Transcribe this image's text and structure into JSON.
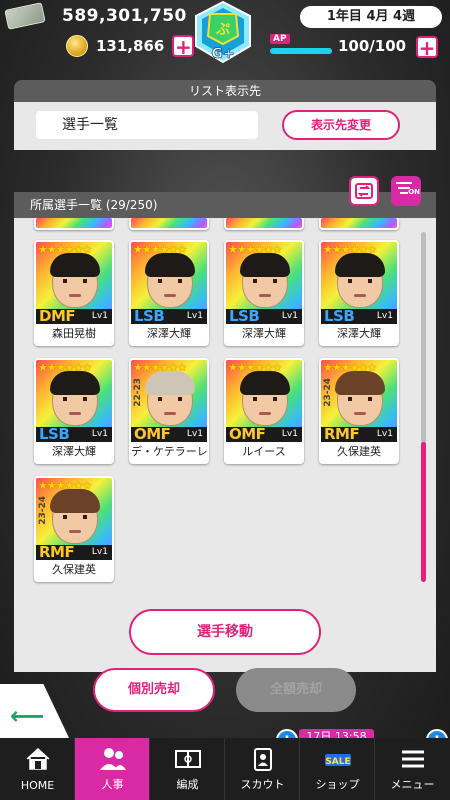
{
  "header": {
    "money": "589,301,750",
    "coins": "131,866",
    "date": "1年目 4月 4週",
    "ap_label": "AP",
    "ap_value": "100/100",
    "ap_fraction": 1.0,
    "plus": "+"
  },
  "list_destination": {
    "title": "リスト表示先",
    "selected": "選手一覧",
    "change_button": "表示先変更"
  },
  "owned": {
    "title": "所属選手一覧 (29/250)",
    "filter_on_label": "ON",
    "players": [
      {
        "position": "DMF",
        "level": "Lv1",
        "name": "森田晃樹",
        "tag": "",
        "hair": "dark",
        "pos_color": "gold",
        "stars": "★★★★★★"
      },
      {
        "position": "LSB",
        "level": "Lv1",
        "name": "深澤大輝",
        "tag": "",
        "hair": "dark",
        "pos_color": "blue",
        "stars": "★★★★★★"
      },
      {
        "position": "LSB",
        "level": "Lv1",
        "name": "深澤大輝",
        "tag": "",
        "hair": "dark",
        "pos_color": "blue",
        "stars": "★★★★★★"
      },
      {
        "position": "LSB",
        "level": "Lv1",
        "name": "深澤大輝",
        "tag": "",
        "hair": "dark",
        "pos_color": "blue",
        "stars": "★★★★★★"
      },
      {
        "position": "LSB",
        "level": "Lv1",
        "name": "深澤大輝",
        "tag": "",
        "hair": "dark",
        "pos_color": "blue",
        "stars": "★★★★★★"
      },
      {
        "position": "OMF",
        "level": "Lv1",
        "name": "デ・ケテラーレ",
        "tag": "22-23",
        "hair": "light",
        "pos_color": "gold",
        "stars": "★★★★★★"
      },
      {
        "position": "OMF",
        "level": "Lv1",
        "name": "ルイース",
        "tag": "",
        "hair": "dark",
        "pos_color": "gold",
        "stars": "★★★★★★"
      },
      {
        "position": "RMF",
        "level": "Lv1",
        "name": "久保建英",
        "tag": "23-24",
        "hair": "brown",
        "pos_color": "gold",
        "stars": "★★★★★★"
      },
      {
        "position": "RMF",
        "level": "Lv1",
        "name": "久保建英",
        "tag": "23-24",
        "hair": "brown",
        "pos_color": "gold",
        "stars": "★★★★★★"
      }
    ],
    "move_button": "選手移動"
  },
  "actions": {
    "individual_sell": "個別売却",
    "sell_all": "全額売却"
  },
  "nav": {
    "items": [
      {
        "label": "HOME",
        "icon": "home-icon"
      },
      {
        "label": "人事",
        "icon": "people-icon"
      },
      {
        "label": "編成",
        "icon": "field-icon"
      },
      {
        "label": "スカウト",
        "icon": "scout-icon"
      },
      {
        "label": "ショップ",
        "icon": "shop-icon"
      },
      {
        "label": "メニュー",
        "icon": "menu-icon"
      }
    ],
    "sale_timer": "17日 13:58",
    "sale_label": "SALE",
    "badge": "!"
  },
  "colors": {
    "accent": "#e0227a",
    "active_nav": "#d92aa6",
    "ap_bar": "#1ad4e8",
    "back_arrow": "#1ea56a"
  }
}
